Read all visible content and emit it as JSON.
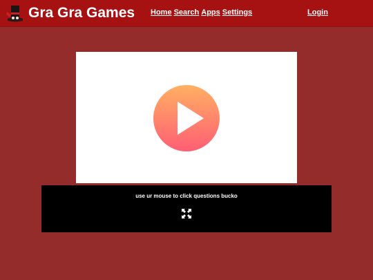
{
  "header": {
    "brand": "Gra Gra Games",
    "nav": {
      "home": "Home",
      "search": "Search",
      "apps": "Apps",
      "settings": "Settings"
    },
    "login": "Login",
    "logo_icon": "red-hat-figure-logo-icon"
  },
  "player": {
    "play_icon": "play-icon",
    "instructions": "use ur mouse to click questions bucko",
    "fullscreen_icon": "fullscreen-expand-icon"
  },
  "colors": {
    "page_background": "#942c2c",
    "header_background": "#a61112",
    "play_gradient_top": "#ffb063",
    "play_gradient_bottom": "#ff5e74",
    "panel_background": "#000000"
  }
}
